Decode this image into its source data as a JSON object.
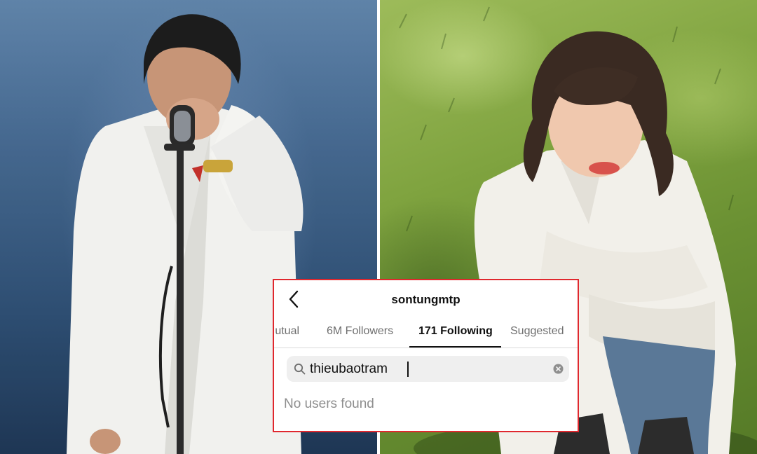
{
  "profile": {
    "username": "sontungmtp"
  },
  "tabs": [
    {
      "label": "Mutual"
    },
    {
      "label": "6M Followers"
    },
    {
      "label": "171 Following"
    },
    {
      "label": "Suggested"
    }
  ],
  "active_tab": "171 Following",
  "search": {
    "value": "thieubaotram"
  },
  "result": {
    "message": "No users found"
  },
  "colors": {
    "highlight_border": "#e0282e",
    "search_bg": "#efefef",
    "muted_text": "#8e8e8e"
  },
  "icons": {
    "back": "chevron-left-icon",
    "search": "search-icon",
    "clear": "clear-circle-icon"
  }
}
